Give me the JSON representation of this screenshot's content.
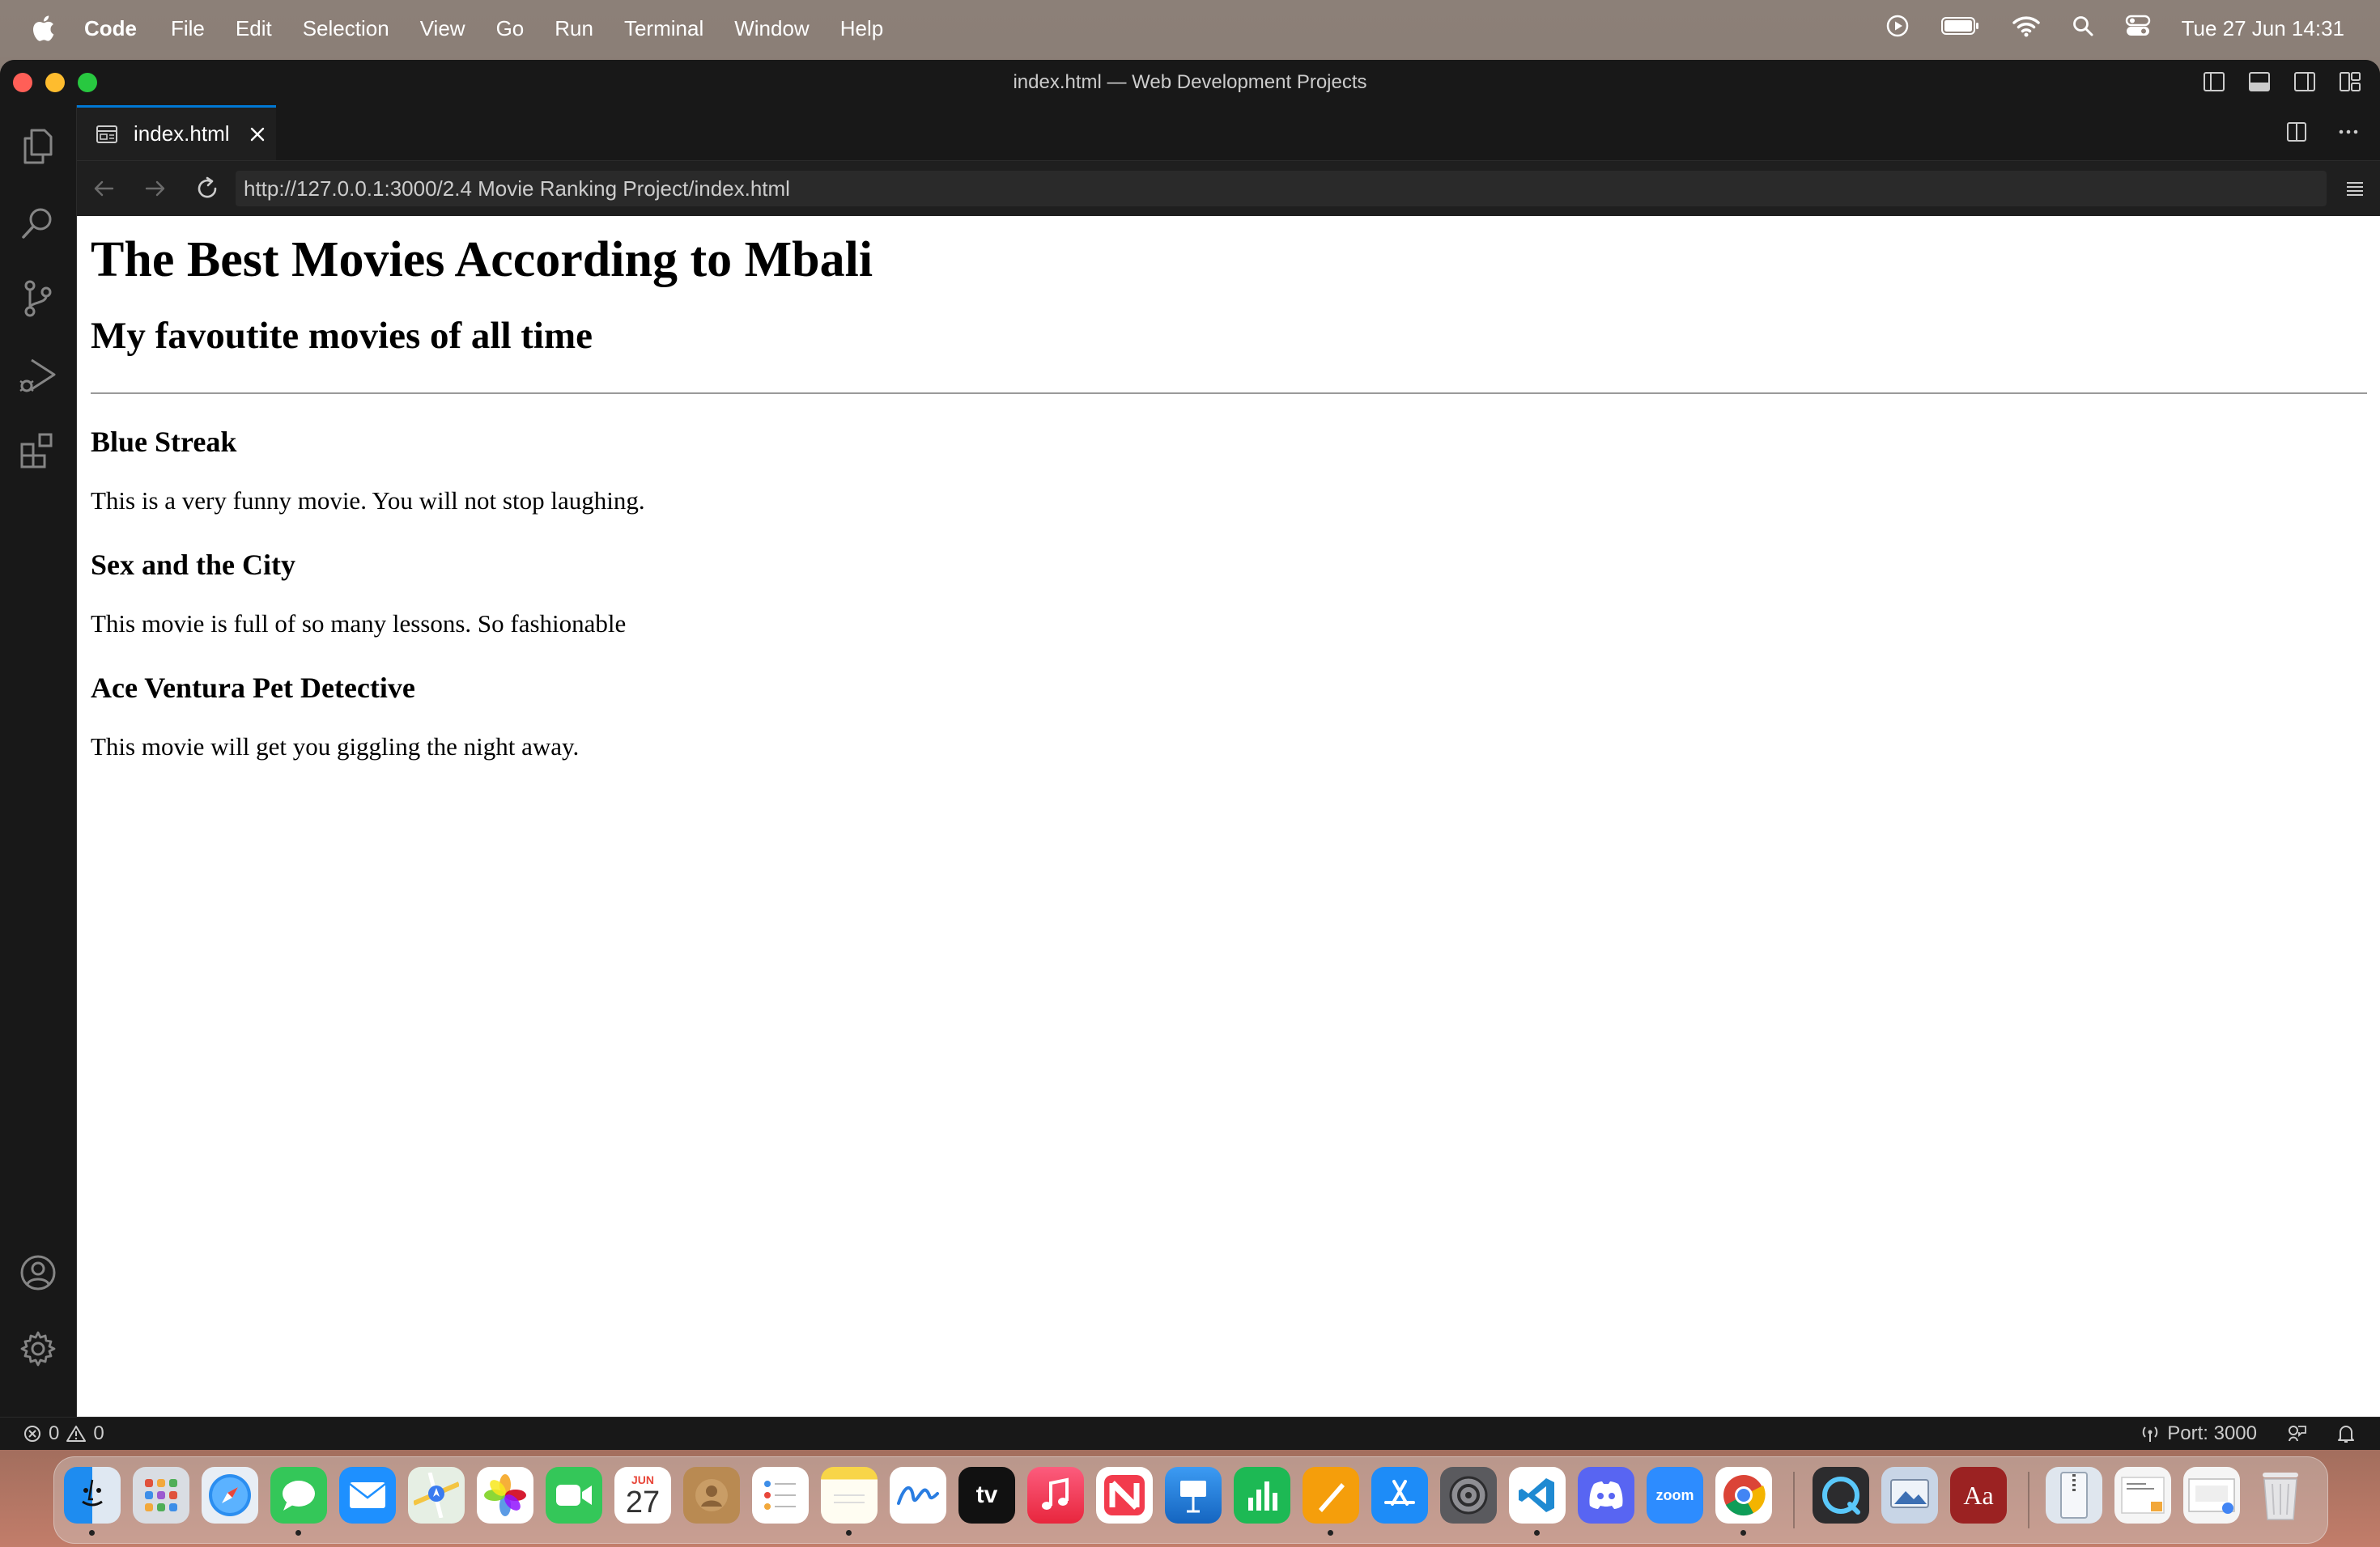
{
  "menubar": {
    "app_name": "Code",
    "items": [
      "File",
      "Edit",
      "Selection",
      "View",
      "Go",
      "Run",
      "Terminal",
      "Window",
      "Help"
    ],
    "clock": "Tue 27 Jun  14:31"
  },
  "window": {
    "title": "index.html — Web Development Projects"
  },
  "tab": {
    "label": "index.html"
  },
  "browser": {
    "url": "http://127.0.0.1:3000/2.4 Movie Ranking Project/index.html"
  },
  "page": {
    "heading": "The Best Movies According to Mbali",
    "subheading": "My favoutite movies of all time",
    "movies": [
      {
        "title": "Blue Streak",
        "description": "This is a very funny movie. You will not stop laughing."
      },
      {
        "title": "Sex and the City",
        "description": "This movie is full of so many lessons. So fashionable"
      },
      {
        "title": "Ace Ventura Pet Detective",
        "description": "This movie will get you giggling the night away."
      }
    ]
  },
  "statusbar": {
    "errors": "0",
    "warnings": "0",
    "port": "Port: 3000"
  },
  "dock": {
    "calendar_month": "JUN",
    "calendar_day": "27",
    "tv_label": "tv",
    "zoom_label": "zoom",
    "dictionary_label": "Aa"
  },
  "colors": {
    "accent": "#0078d4",
    "editor_bg": "#1e1e1e",
    "chrome_bg": "#181818"
  }
}
